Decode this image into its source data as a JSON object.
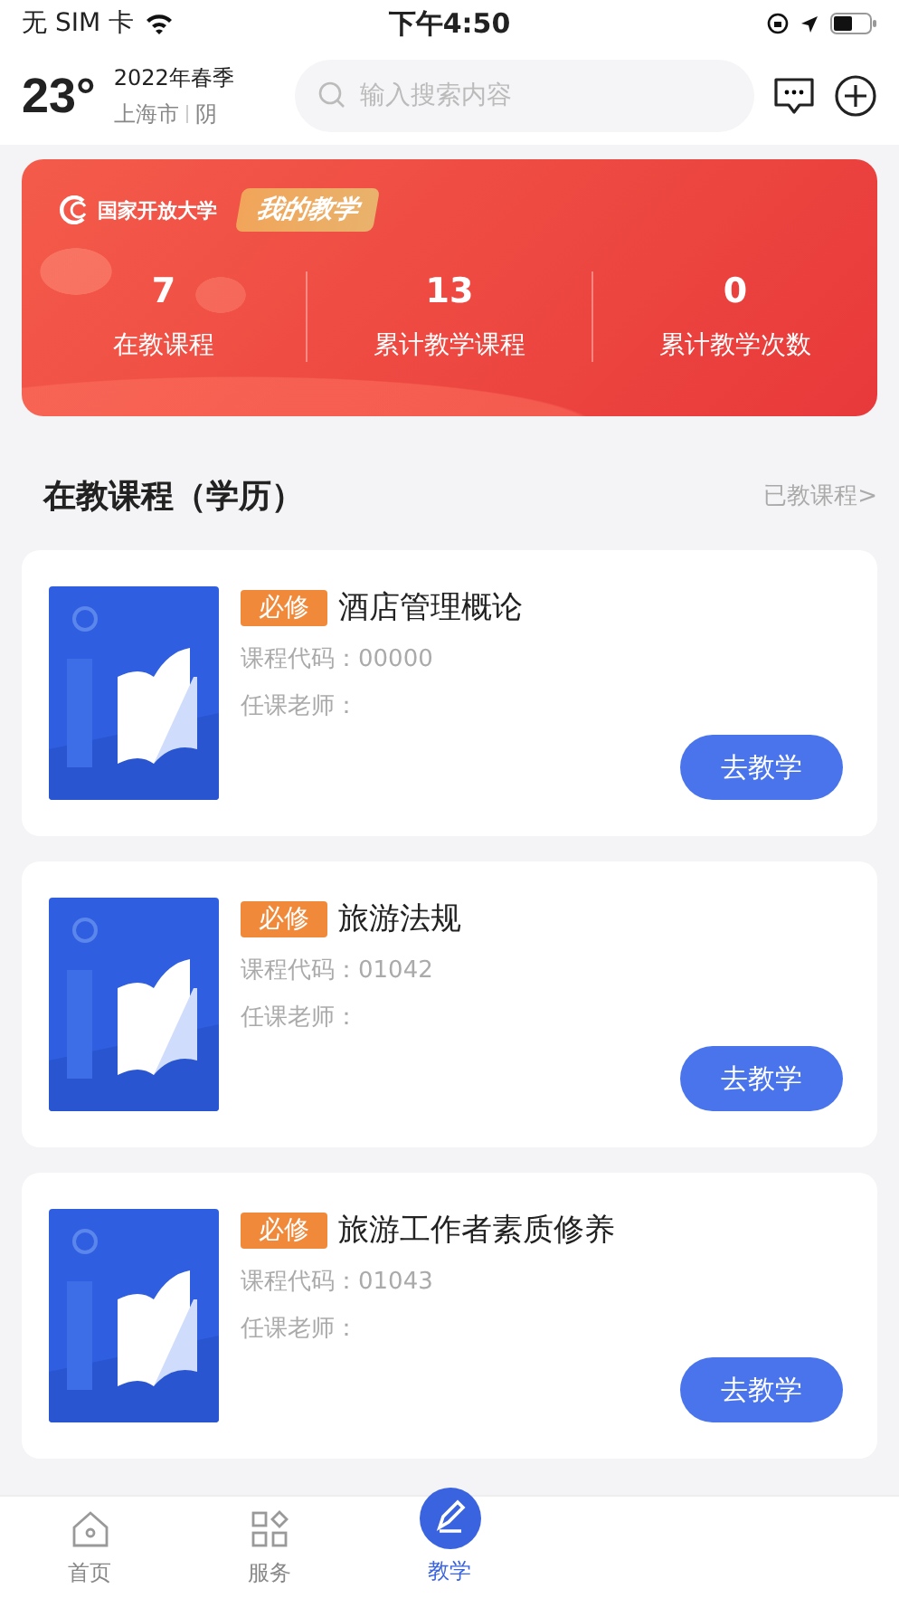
{
  "status_bar": {
    "carrier": "无 SIM 卡",
    "time": "下午4:50"
  },
  "header": {
    "temperature": "23°",
    "term": "2022年春季",
    "city": "上海市",
    "weather": "阴",
    "search": {
      "placeholder": "输入搜索内容"
    }
  },
  "banner": {
    "logo": "国家开放大学",
    "title": "我的教学",
    "stats": [
      {
        "value": "7",
        "label": "在教课程"
      },
      {
        "value": "13",
        "label": "累计教学课程"
      },
      {
        "value": "0",
        "label": "累计教学次数"
      }
    ]
  },
  "section": {
    "title": "在教课程（学历）",
    "link": "已教课程>"
  },
  "courses": [
    {
      "tag": "必修",
      "name": "酒店管理概论",
      "code": "课程代码：00000",
      "teacher": "任课老师：",
      "button": "去教学"
    },
    {
      "tag": "必修",
      "name": "旅游法规",
      "code": "课程代码：01042",
      "teacher": "任课老师：",
      "button": "去教学"
    },
    {
      "tag": "必修",
      "name": "旅游工作者素质修养",
      "code": "课程代码：01043",
      "teacher": "任课老师：",
      "button": "去教学"
    }
  ],
  "tab_bar": [
    {
      "label": "首页",
      "kind": "home",
      "selected": false
    },
    {
      "label": "服务",
      "kind": "grid",
      "selected": false
    },
    {
      "label": "教学",
      "kind": "teach",
      "selected": true
    }
  ]
}
